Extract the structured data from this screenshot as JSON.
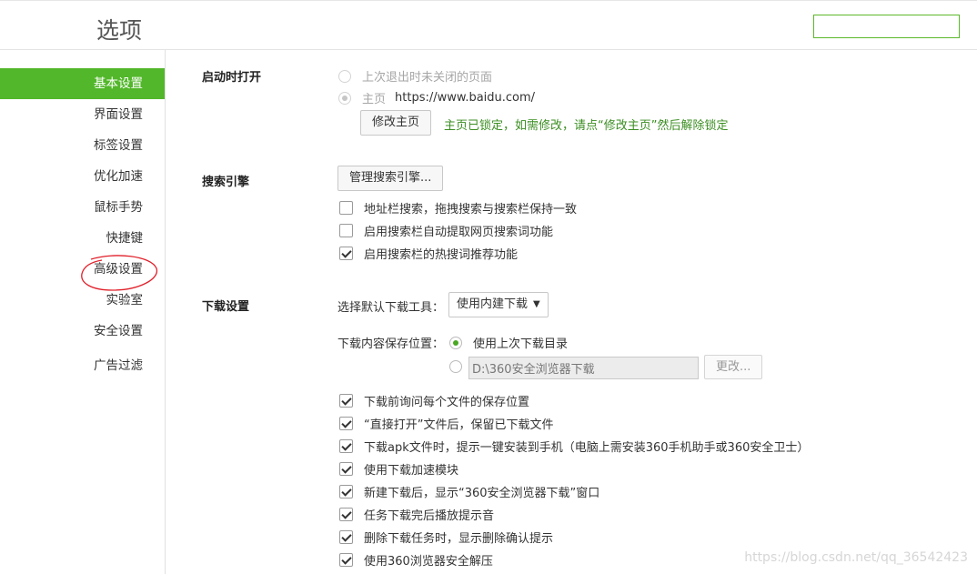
{
  "header": {
    "title": "选项",
    "search_value": ""
  },
  "sidebar": {
    "items": [
      {
        "label": "基本设置",
        "active": true
      },
      {
        "label": "界面设置"
      },
      {
        "label": "标签设置"
      },
      {
        "label": "优化加速"
      },
      {
        "label": "鼠标手势"
      },
      {
        "label": "快捷键"
      },
      {
        "label": "高级设置"
      },
      {
        "label": "实验室"
      },
      {
        "label": "安全设置"
      },
      {
        "label": "广告过滤"
      }
    ]
  },
  "startup": {
    "title": "启动时打开",
    "option_last": "上次退出时未关闭的页面",
    "option_home_label": "主页",
    "home_url": "https://www.baidu.com/",
    "change_home_button": "修改主页",
    "locked_note": "主页已锁定，如需修改，请点“修改主页”然后解除锁定"
  },
  "search_engine": {
    "title": "搜索引擎",
    "manage_button": "管理搜索引擎...",
    "options": [
      {
        "label": "地址栏搜索，拖拽搜索与搜索栏保持一致",
        "checked": false
      },
      {
        "label": "启用搜索栏自动提取网页搜索词功能",
        "checked": false
      },
      {
        "label": "启用搜索栏的热搜词推荐功能",
        "checked": true
      }
    ]
  },
  "download": {
    "title": "下载设置",
    "tool_label": "选择默认下载工具：",
    "tool_selected": "使用内建下载",
    "location_label": "下载内容保存位置：",
    "location_last": "使用上次下载目录",
    "location_path": "D:\\360安全浏览器下载",
    "change_button": "更改...",
    "options": [
      {
        "label": "下载前询问每个文件的保存位置",
        "checked": true
      },
      {
        "label": "“直接打开”文件后，保留已下载文件",
        "checked": true
      },
      {
        "label": "下载apk文件时，提示一键安装到手机（电脑上需安装360手机助手或360安全卫士）",
        "checked": true
      },
      {
        "label": "使用下载加速模块",
        "checked": true
      },
      {
        "label": "新建下载后，显示“360安全浏览器下载”窗口",
        "checked": true
      },
      {
        "label": "任务下载完后播放提示音",
        "checked": true
      },
      {
        "label": "删除下载任务时，显示删除确认提示",
        "checked": true
      },
      {
        "label": "使用360浏览器安全解压",
        "checked": true
      }
    ]
  },
  "watermark": "https://blog.csdn.net/qq_36542423",
  "colors": {
    "accent": "#52b72a",
    "locked_note": "#3b8e22",
    "annotation": "#e0202a"
  }
}
